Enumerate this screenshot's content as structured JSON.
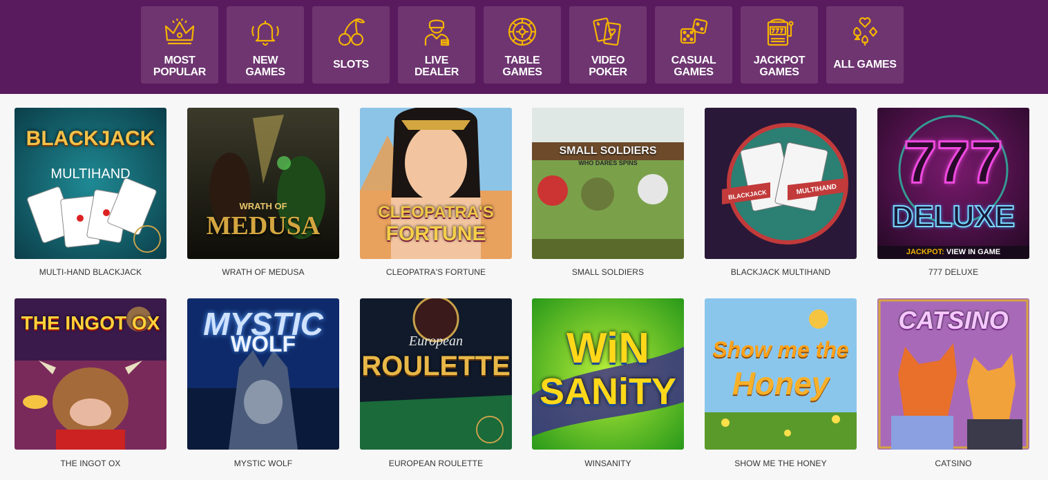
{
  "nav": {
    "categories": [
      {
        "label": "MOST\nPOPULAR",
        "icon": "crown-icon"
      },
      {
        "label": "NEW\nGAMES",
        "icon": "bell-icon"
      },
      {
        "label": "SLOTS",
        "icon": "cherries-icon"
      },
      {
        "label": "LIVE\nDEALER",
        "icon": "dealer-icon"
      },
      {
        "label": "TABLE\nGAMES",
        "icon": "roulette-wheel-icon"
      },
      {
        "label": "VIDEO\nPOKER",
        "icon": "playing-cards-icon"
      },
      {
        "label": "CASUAL\nGAMES",
        "icon": "dice-icon"
      },
      {
        "label": "JACKPOT\nGAMES",
        "icon": "slot-machine-icon"
      },
      {
        "label": "ALL GAMES",
        "icon": "card-suits-icon"
      }
    ]
  },
  "games": [
    {
      "caption": "MULTI-HAND BLACKJACK",
      "art_title": "BLACKJACK",
      "art_sub": "MULTIHAND"
    },
    {
      "caption": "WRATH OF MEDUSA",
      "art_title": "MEDUSA",
      "art_sub": "WRATH OF"
    },
    {
      "caption": "CLEOPATRA'S FORTUNE",
      "art_title": "CLEOPATRA'S",
      "art_sub": "FORTUNE"
    },
    {
      "caption": "SMALL SOLDIERS",
      "art_title": "SMALL SOLDIERS",
      "art_sub": "WHO DARES SPINS"
    },
    {
      "caption": "BLACKJACK MULTIHAND",
      "art_title": "BLACKJACK",
      "art_sub": "MULTIHAND"
    },
    {
      "caption": "777 DELUXE",
      "art_title": "777",
      "art_sub": "DELUXE",
      "jackpot_label": "JACKPOT:",
      "jackpot_value": "VIEW IN GAME"
    },
    {
      "caption": "THE INGOT OX",
      "art_title": "THE INGOT OX"
    },
    {
      "caption": "MYSTIC WOLF",
      "art_title": "MYSTIC",
      "art_sub": "WOLF"
    },
    {
      "caption": "EUROPEAN ROULETTE",
      "art_title": "ROULETTE",
      "art_sub": "European"
    },
    {
      "caption": "WINSANITY",
      "art_title": "WiN",
      "art_sub": "SANiTY"
    },
    {
      "caption": "SHOW ME THE HONEY",
      "art_title": "Show me the",
      "art_sub": "Honey"
    },
    {
      "caption": "CATSINO",
      "art_title": "CATSINO"
    }
  ],
  "colors": {
    "topbar": "#5a1a5e",
    "tile": "#6e3571",
    "icon_gold": "#f5b400",
    "page_bg": "#f7f7f7"
  }
}
